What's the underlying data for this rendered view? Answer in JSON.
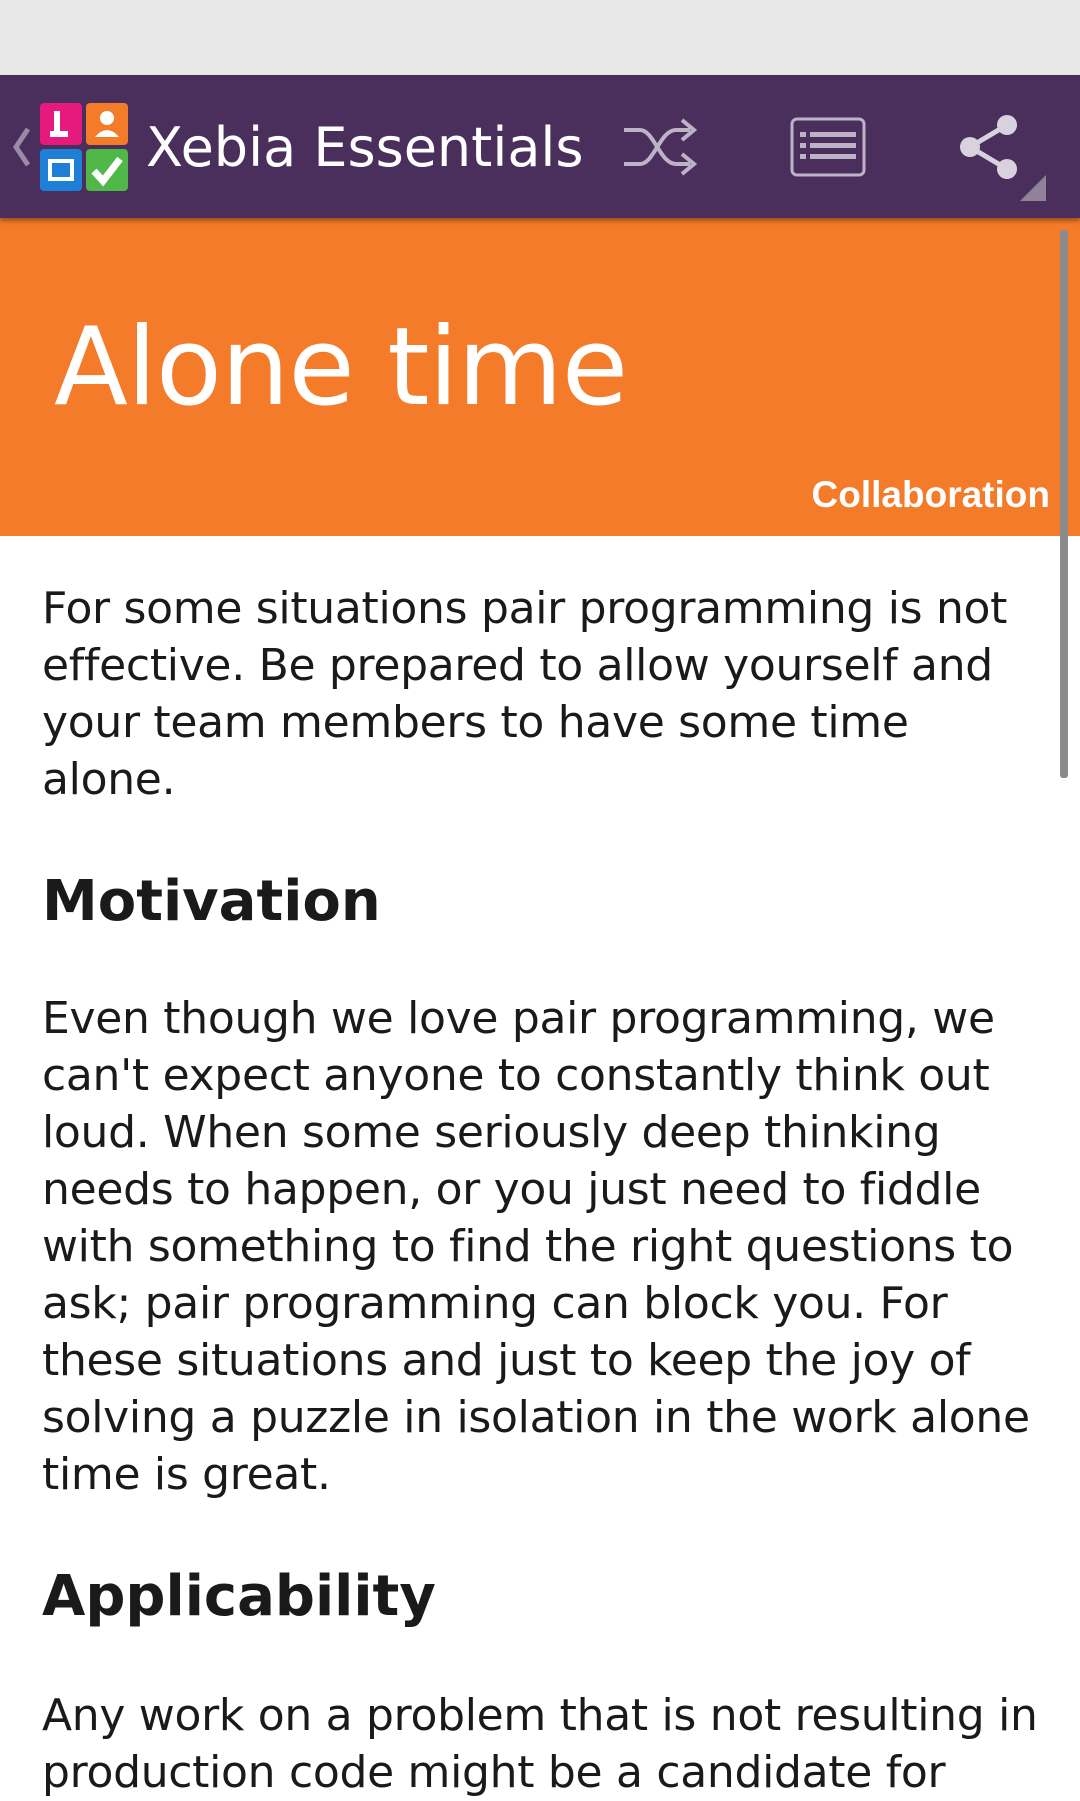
{
  "action_bar": {
    "title": "Xebia Essentials",
    "actions": [
      "shuffle",
      "card-list",
      "share"
    ]
  },
  "card": {
    "title": "Alone time",
    "category": "Collaboration",
    "header_color": "#f47b2a",
    "intro": "For some situations pair programming is not effective. Be prepared to allow yourself and your team members to have some time alone.",
    "sections": [
      {
        "heading": "Motivation",
        "body": "Even though we love pair programming, we can't expect anyone to constantly think out loud. When some seriously deep thinking needs to happen, or you just need to fiddle with something to find the right questions to ask; pair programming can block you. For these situations and just to keep the joy of solving a puzzle in isolation in the work alone time is great."
      },
      {
        "heading": "Applicability",
        "body": "Any work on a problem that is not resulting in production code might be a candidate for"
      }
    ]
  },
  "colors": {
    "action_bar": "#4a2f5c",
    "accent": "#f47b2a"
  }
}
